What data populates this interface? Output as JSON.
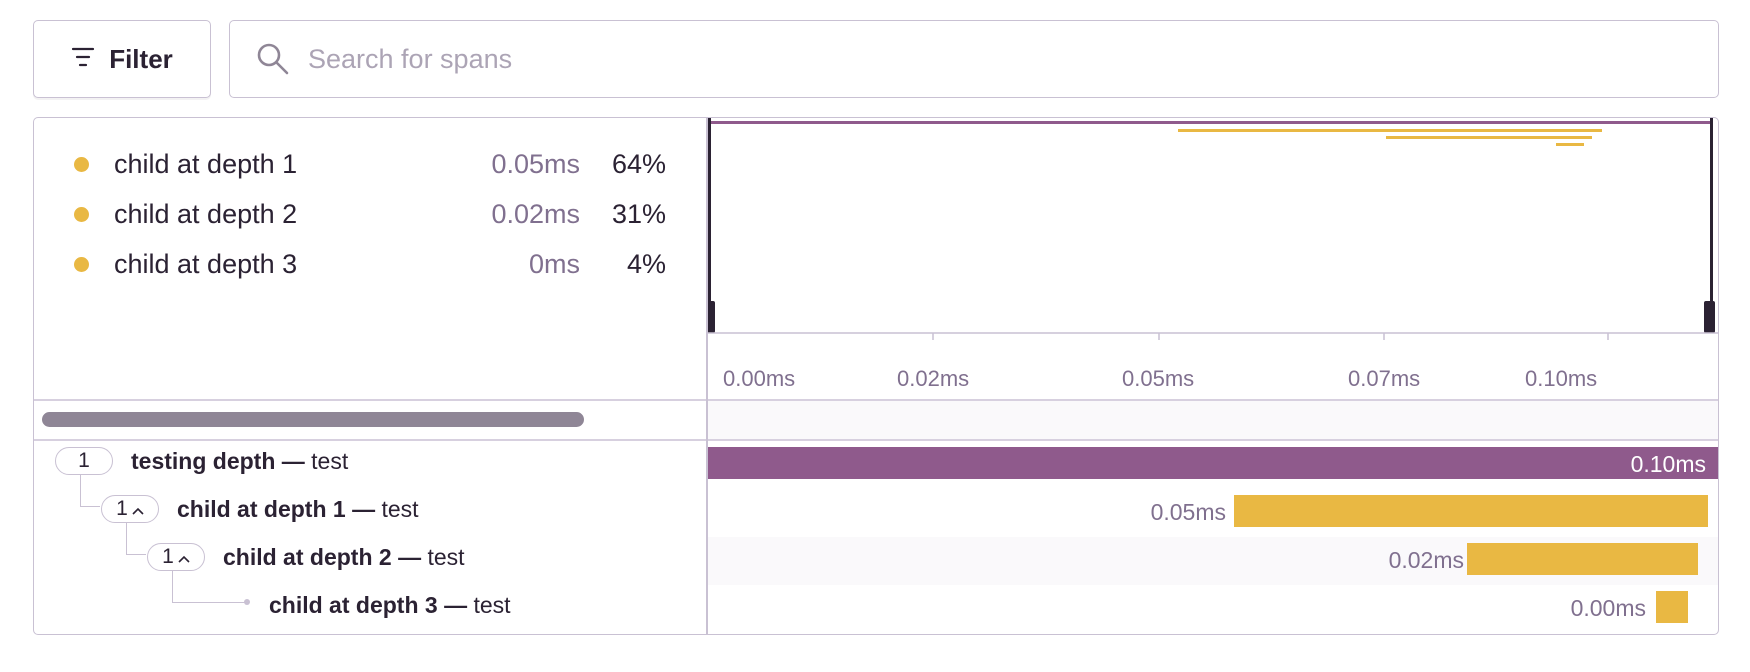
{
  "toolbar": {
    "filter_label": "Filter",
    "search_placeholder": "Search for spans"
  },
  "legend": {
    "items": [
      {
        "label": "child at depth 1",
        "duration": "0.05ms",
        "percent": "64%"
      },
      {
        "label": "child at depth 2",
        "duration": "0.02ms",
        "percent": "31%"
      },
      {
        "label": "child at depth 3",
        "duration": "0ms",
        "percent": "4%"
      }
    ]
  },
  "timeline": {
    "ticks": [
      "0.00ms",
      "0.02ms",
      "0.05ms",
      "0.07ms",
      "0.10ms"
    ]
  },
  "spans": [
    {
      "count": "1",
      "op": "testing depth —",
      "desc": "test",
      "duration_label": "0.10ms"
    },
    {
      "count": "1",
      "op": "child at depth 1 —",
      "desc": "test",
      "duration_label": "0.05ms"
    },
    {
      "count": "1",
      "op": "child at depth 2 —",
      "desc": "test",
      "duration_label": "0.02ms"
    },
    {
      "count": "",
      "op": "child at depth 3 —",
      "desc": "test",
      "duration_label": "0.00ms"
    }
  ],
  "colors": {
    "root_span": "#8f5a8c",
    "child_span": "#e9b843",
    "border": "#c9c1d3",
    "muted_text": "#80708f"
  }
}
